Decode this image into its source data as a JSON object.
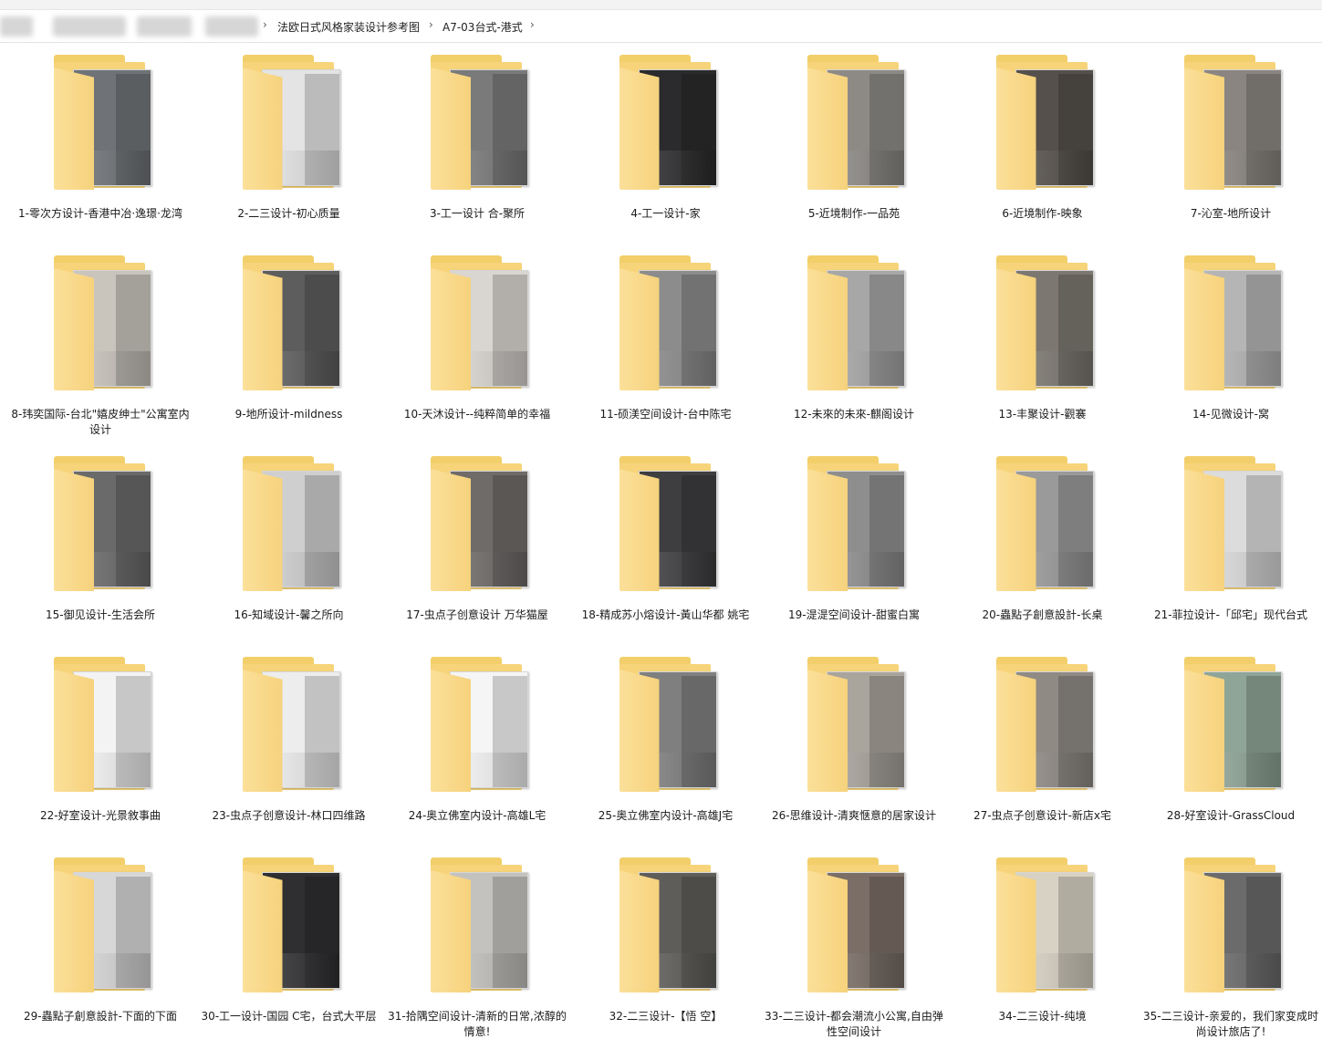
{
  "breadcrumb": {
    "items": [
      "法欧日式风格家装设计参考图",
      "A7-03台式-港式"
    ],
    "separator": "›"
  },
  "folders": [
    {
      "label": "1-零次方设计-香港中冶·逸璟·龙湾",
      "photo": "#6f7377"
    },
    {
      "label": "2-二三设计-初心质量",
      "photo": "#e4e4e4"
    },
    {
      "label": "3-工一设计 合-聚所",
      "photo": "#7a7a7a"
    },
    {
      "label": "4-工一设计-家",
      "photo": "#2b2b2d"
    },
    {
      "label": "5-近境制作-一品苑",
      "photo": "#8d8a86"
    },
    {
      "label": "6-近境制作-映象",
      "photo": "#55504b"
    },
    {
      "label": "7-沁室-地所设计",
      "photo": "#8a8580"
    },
    {
      "label": "8-玮奕国际-台北\"嬉皮绅士\"公寓室内设计",
      "photo": "#c9c4bc"
    },
    {
      "label": "9-地所设计-mildness",
      "photo": "#5d5d5d"
    },
    {
      "label": "10-天沐设计--纯粹简单的幸福",
      "photo": "#d9d6d1"
    },
    {
      "label": "11-硕渼空间设计-台中陈宅",
      "photo": "#8c8c8c"
    },
    {
      "label": "12-未來的未來-麒阁设计",
      "photo": "#a7a7a7"
    },
    {
      "label": "13-丰聚设计-觀褰",
      "photo": "#7c7770"
    },
    {
      "label": "14-见微设计-窝",
      "photo": "#b5b5b5"
    },
    {
      "label": "15-御见设计-生活会所",
      "photo": "#6a6a6a"
    },
    {
      "label": "16-知域设计-馨之所向",
      "photo": "#cfcfcf"
    },
    {
      "label": "17-虫点子创意设计 万华猫屋",
      "photo": "#6e6b68"
    },
    {
      "label": "18-精成苏小熔设计-黃山华都 姚宅",
      "photo": "#3e3e40"
    },
    {
      "label": "19-湜湜空间设计-甜蜜白寓",
      "photo": "#8e8e8e"
    },
    {
      "label": "20-蟲點子創意設計-长桌",
      "photo": "#9a9a9a"
    },
    {
      "label": "21-菲拉设计-「邱宅」现代台式",
      "photo": "#dcdcdc"
    },
    {
      "label": "22-好室设计-光景敘事曲",
      "photo": "#f3f3f3"
    },
    {
      "label": "23-虫点子创意设计-林口四维路",
      "photo": "#ededed"
    },
    {
      "label": "24-奥立佛室内设计-高雄L宅",
      "photo": "#f5f5f5"
    },
    {
      "label": "25-奥立佛室内设计-高雄J宅",
      "photo": "#7f7f7f"
    },
    {
      "label": "26-思维设计-清爽惬意的居家设计",
      "photo": "#a9a49c"
    },
    {
      "label": "27-虫点子创意设计-新店x宅",
      "photo": "#8f8a84"
    },
    {
      "label": "28-好室设计-GrassCloud",
      "photo": "#8fa597"
    },
    {
      "label": "29-蟲點子創意設計-下面的下面",
      "photo": "#d7d7d7"
    },
    {
      "label": "30-工一设计-国园 C宅，台式大平层",
      "photo": "#2f2f31"
    },
    {
      "label": "31-拾隅空间设计-清新的日常,浓醇的情意!",
      "photo": "#c4c2be"
    },
    {
      "label": "32-二三设计-【悟 空】",
      "photo": "#5f5d59"
    },
    {
      "label": "33-二三设计-都会潮流小公寓,自由弹性空间设计",
      "photo": "#7a6e66"
    },
    {
      "label": "34-二三设计-纯境",
      "photo": "#d8d2c4"
    },
    {
      "label": "35-二三设计-亲爱的，我们家变成时尚设计旅店了!",
      "photo": "#6b6b6b"
    }
  ]
}
